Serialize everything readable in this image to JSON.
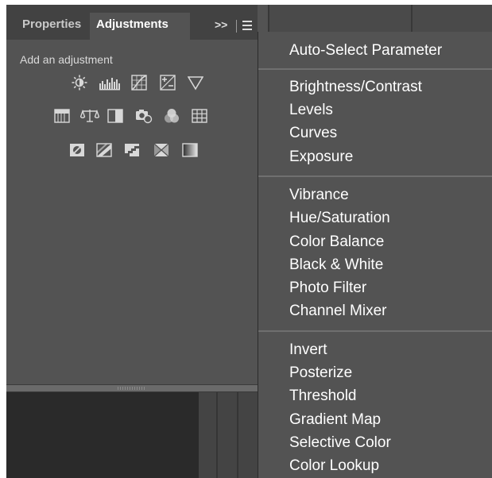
{
  "tabs": [
    {
      "label": "Properties",
      "active": false
    },
    {
      "label": "Adjustments",
      "active": true
    }
  ],
  "panel_controls": {
    "collapse_label": ">>"
  },
  "hint": "Add an adjustment",
  "icons": {
    "row1": [
      "brightness-contrast-icon",
      "levels-icon",
      "curves-icon",
      "exposure-icon",
      "vibrance-icon"
    ],
    "row2": [
      "hue-saturation-icon",
      "color-balance-icon",
      "black-white-icon",
      "photo-filter-icon",
      "channel-mixer-icon",
      "color-lookup-icon"
    ],
    "row3": [
      "invert-icon",
      "posterize-icon",
      "threshold-icon",
      "selective-color-icon",
      "gradient-map-icon"
    ]
  },
  "menu": {
    "auto_select": "Auto-Select Parameter",
    "group1": [
      "Brightness/Contrast",
      "Levels",
      "Curves",
      "Exposure"
    ],
    "group2": [
      "Vibrance",
      "Hue/Saturation",
      "Color Balance",
      "Black & White",
      "Photo Filter",
      "Channel Mixer"
    ],
    "group3": [
      "Invert",
      "Posterize",
      "Threshold",
      "Gradient Map",
      "Selective Color",
      "Color Lookup"
    ]
  },
  "colors": {
    "panel_bg": "#535353",
    "tab_bar_bg": "#424242",
    "text": "#ffffff",
    "dark_area": "#2a2a2a"
  }
}
